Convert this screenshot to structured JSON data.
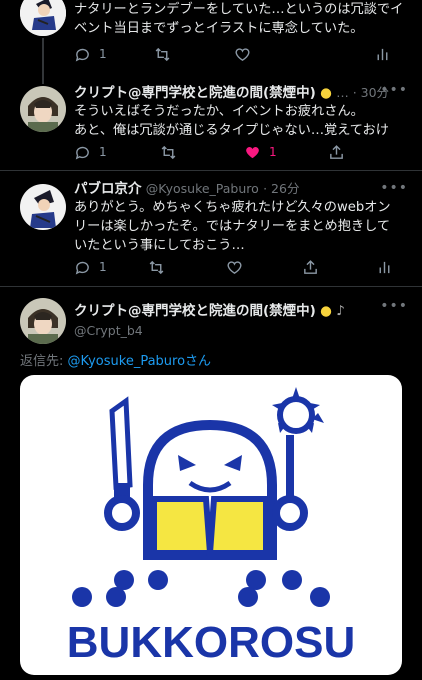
{
  "tweets": [
    {
      "id": "t0",
      "text": "ナタリーとランデブーをしていた…というのは冗談でイ\nベント当日までずっとイラストに専念していた。",
      "reply_count": "1"
    },
    {
      "id": "t1",
      "name": "クリプト@専門学校と院進の間(禁煙中)",
      "handle_time": "… · 30分",
      "text": "そういえばそうだったか、イベントお疲れさん。\nあと、俺は冗談が通じるタイプじゃない…覚えておけ",
      "reply_count": "1",
      "like_count": "1"
    },
    {
      "id": "t2",
      "name": "パブロ京介",
      "handle": "@Kyosuke_Paburo",
      "time": "· 26分",
      "text": "ありがとう。めちゃくちゃ疲れたけど久々のwebオン\nリーは楽しかったぞ。ではナタリーをまとめ抱きして\nいたという事にしておこう…",
      "reply_count": "1"
    },
    {
      "id": "t3",
      "name": "クリプト@専門学校と院進の間(禁煙中)",
      "handle": "@Crypt_b4"
    }
  ],
  "replying": {
    "label": "返信先:",
    "mention": "@Kyosuke_Paburoさん"
  },
  "image": {
    "logo_text": "BUKKOROSU",
    "brand_color": "#1a35a8",
    "accent_color": "#f5e642"
  },
  "colors": {
    "background": "#000000",
    "like": "#f91880",
    "link": "#1d9bf0"
  }
}
